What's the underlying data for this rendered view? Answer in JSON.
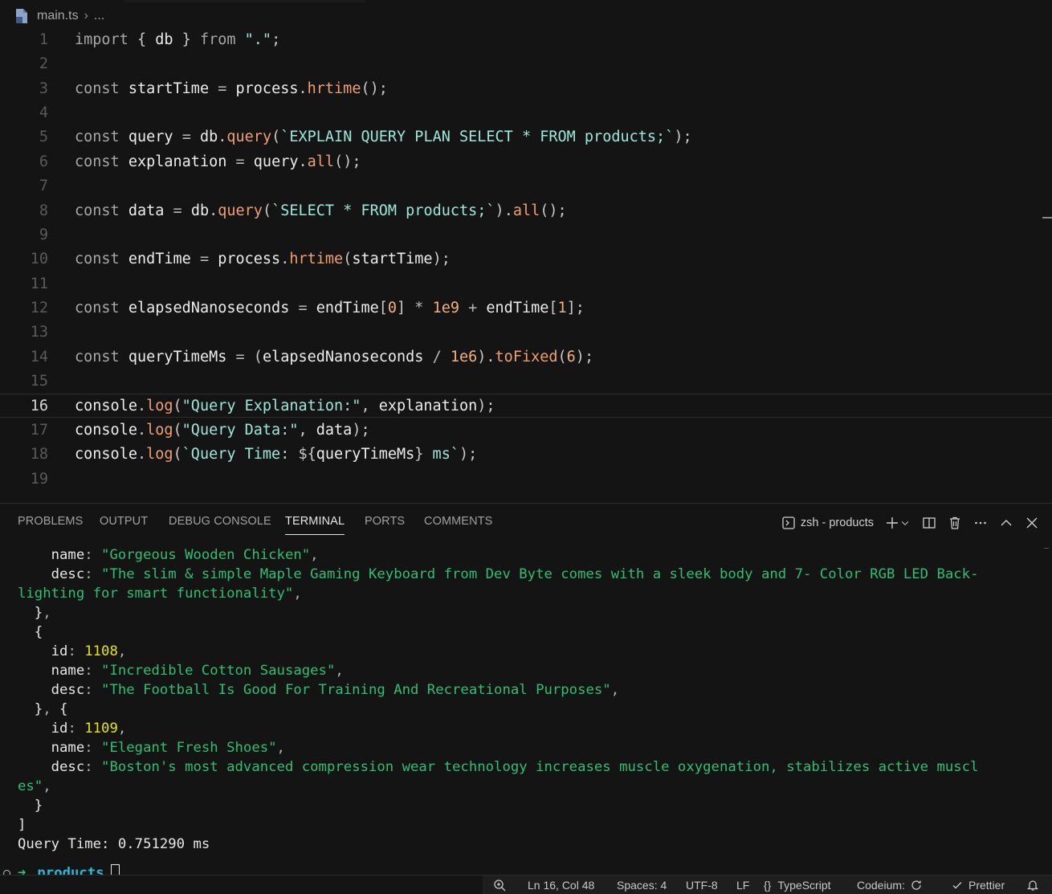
{
  "breadcrumb": {
    "file": "main.ts",
    "ellipsis": "..."
  },
  "editor": {
    "active_line": 16,
    "line_numbers": [
      "1",
      "2",
      "3",
      "4",
      "5",
      "6",
      "7",
      "8",
      "9",
      "10",
      "11",
      "12",
      "13",
      "14",
      "15",
      "16",
      "17",
      "18",
      "19"
    ]
  },
  "panel": {
    "tabs": [
      "PROBLEMS",
      "OUTPUT",
      "DEBUG CONSOLE",
      "TERMINAL",
      "PORTS",
      "COMMENTS"
    ],
    "active_tab": "TERMINAL",
    "terminal_name": "zsh - products"
  },
  "terminal": {
    "lines": [
      [
        [
          "    name",
          "key"
        ],
        [
          ": ",
          "pun"
        ],
        [
          "\"Gorgeous Wooden Chicken\"",
          "str"
        ],
        [
          ",",
          "pun"
        ]
      ],
      [
        [
          "    desc",
          "key"
        ],
        [
          ": ",
          "pun"
        ],
        [
          "\"The slim & simple Maple Gaming Keyboard from Dev Byte comes with a sleek body and 7- Color RGB LED Back-",
          "str"
        ]
      ],
      [
        [
          "lighting for smart functionality\"",
          "str"
        ],
        [
          ",",
          "pun"
        ]
      ],
      [
        [
          "  }",
          "key"
        ],
        [
          ",",
          "pun"
        ]
      ],
      [
        [
          "  {",
          "key"
        ]
      ],
      [
        [
          "    id",
          "key"
        ],
        [
          ": ",
          "pun"
        ],
        [
          "1108",
          "num"
        ],
        [
          ",",
          "pun"
        ]
      ],
      [
        [
          "    name",
          "key"
        ],
        [
          ": ",
          "pun"
        ],
        [
          "\"Incredible Cotton Sausages\"",
          "str"
        ],
        [
          ",",
          "pun"
        ]
      ],
      [
        [
          "    desc",
          "key"
        ],
        [
          ": ",
          "pun"
        ],
        [
          "\"The Football Is Good For Training And Recreational Purposes\"",
          "str"
        ],
        [
          ",",
          "pun"
        ]
      ],
      [
        [
          "  }",
          "key"
        ],
        [
          ", ",
          "pun"
        ],
        [
          "{",
          "key"
        ]
      ],
      [
        [
          "    id",
          "key"
        ],
        [
          ": ",
          "pun"
        ],
        [
          "1109",
          "num"
        ],
        [
          ",",
          "pun"
        ]
      ],
      [
        [
          "    name",
          "key"
        ],
        [
          ": ",
          "pun"
        ],
        [
          "\"Elegant Fresh Shoes\"",
          "str"
        ],
        [
          ",",
          "pun"
        ]
      ],
      [
        [
          "    desc",
          "key"
        ],
        [
          ": ",
          "pun"
        ],
        [
          "\"Boston's most advanced compression wear technology increases muscle oxygenation, stabilizes active muscl",
          "str"
        ]
      ],
      [
        [
          "es\"",
          "str"
        ],
        [
          ",",
          "pun"
        ]
      ],
      [
        [
          "  }",
          "key"
        ]
      ],
      [
        [
          "]",
          "key"
        ]
      ],
      [
        [
          "Query Time: 0.751290 ms",
          "key"
        ]
      ]
    ],
    "prompt_arrow": "➜",
    "prompt_dir": "products"
  },
  "statusbar": {
    "position": "Ln 16, Col 48",
    "spaces": "Spaces: 4",
    "encoding": "UTF-8",
    "eol": "LF",
    "language_braces": "{}",
    "language": "TypeScript",
    "codeium": "Codeium:",
    "prettier": "Prettier"
  }
}
